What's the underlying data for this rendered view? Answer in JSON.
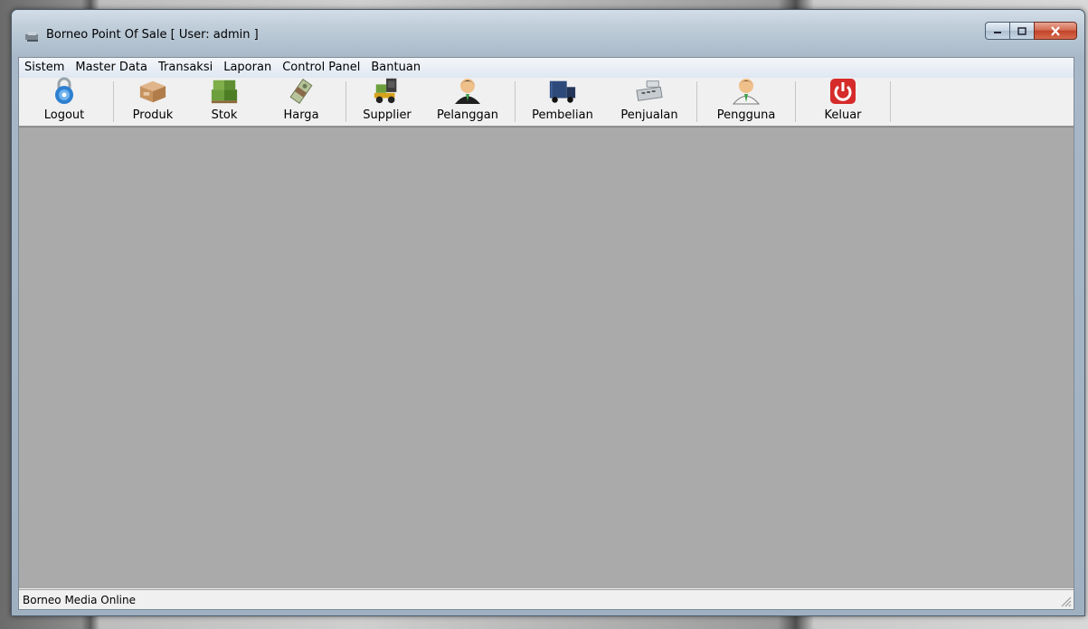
{
  "window": {
    "title": "Borneo Point Of Sale [ User: admin ]"
  },
  "menu": [
    "Sistem",
    "Master Data",
    "Transaksi",
    "Laporan",
    "Control Panel",
    "Bantuan"
  ],
  "toolbar": {
    "logout": "Logout",
    "produk": "Produk",
    "stok": "Stok",
    "harga": "Harga",
    "supplier": "Supplier",
    "pelanggan": "Pelanggan",
    "pembelian": "Pembelian",
    "penjualan": "Penjualan",
    "pengguna": "Pengguna",
    "keluar": "Keluar"
  },
  "status": {
    "text": "Borneo Media Online"
  },
  "colors": {
    "workspace": "#aaaaaa",
    "close_button": "#c2432a",
    "keluar_icon": "#d62b2b",
    "logout_icon": "#2d7fd0"
  }
}
